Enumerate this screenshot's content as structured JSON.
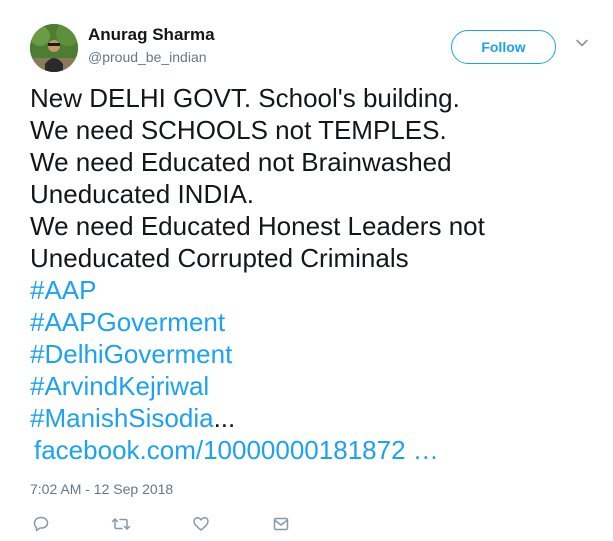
{
  "user": {
    "name": "Anurag Sharma",
    "handle": "@proud_be_indian",
    "avatar_icon": "profile-photo"
  },
  "follow_button": {
    "label": "Follow"
  },
  "menu": {
    "icon": "chevron-down-icon"
  },
  "tweet": {
    "lines": [
      "New DELHI GOVT. School's building.",
      "We need SCHOOLS not TEMPLES.",
      "We need Educated not Brainwashed",
      "Uneducated INDIA.",
      "We need Educated Honest Leaders not",
      "Uneducated Corrupted Criminals"
    ],
    "hashtags": [
      "#AAP",
      "#AAPGoverment",
      "#DelhiGoverment",
      "#ArvindKejriwal",
      "#ManishSisodia"
    ],
    "truncation": "...",
    "link_text": "facebook.com/10000000181872 …"
  },
  "timestamp": "7:02 AM - 12 Sep 2018",
  "actions": {
    "reply_icon": "reply-icon",
    "retweet_icon": "retweet-icon",
    "like_icon": "heart-icon",
    "dm_icon": "envelope-icon"
  },
  "colors": {
    "accent": "#1da1f2",
    "text": "#14171a",
    "muted": "#657786",
    "icon": "#8899a6"
  }
}
